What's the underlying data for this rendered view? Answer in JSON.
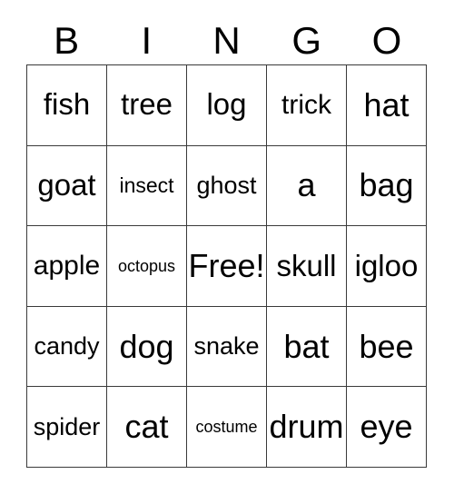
{
  "card": {
    "header": {
      "letters": [
        "B",
        "I",
        "N",
        "G",
        "O"
      ]
    },
    "rows": [
      [
        {
          "text": "fish",
          "size": "lg"
        },
        {
          "text": "tree",
          "size": "lg"
        },
        {
          "text": "log",
          "size": "lg"
        },
        {
          "text": "trick",
          "size": "md"
        },
        {
          "text": "hat",
          "size": "xl"
        }
      ],
      [
        {
          "text": "goat",
          "size": "lg"
        },
        {
          "text": "insect",
          "size": "xs"
        },
        {
          "text": "ghost",
          "size": "sm"
        },
        {
          "text": "a",
          "size": "xl"
        },
        {
          "text": "bag",
          "size": "xl"
        }
      ],
      [
        {
          "text": "apple",
          "size": "md"
        },
        {
          "text": "octopus",
          "size": "xxs"
        },
        {
          "text": "Free!",
          "size": "xl"
        },
        {
          "text": "skull",
          "size": "lg"
        },
        {
          "text": "igloo",
          "size": "lg"
        }
      ],
      [
        {
          "text": "candy",
          "size": "sm"
        },
        {
          "text": "dog",
          "size": "xl"
        },
        {
          "text": "snake",
          "size": "sm"
        },
        {
          "text": "bat",
          "size": "xl"
        },
        {
          "text": "bee",
          "size": "xl"
        }
      ],
      [
        {
          "text": "spider",
          "size": "sm"
        },
        {
          "text": "cat",
          "size": "xl"
        },
        {
          "text": "costume",
          "size": "xxs"
        },
        {
          "text": "drum",
          "size": "xl"
        },
        {
          "text": "eye",
          "size": "xl"
        }
      ]
    ],
    "colors": {
      "background": "#ffffff",
      "text": "#000000",
      "grid_line": "#3a3a3a"
    }
  }
}
